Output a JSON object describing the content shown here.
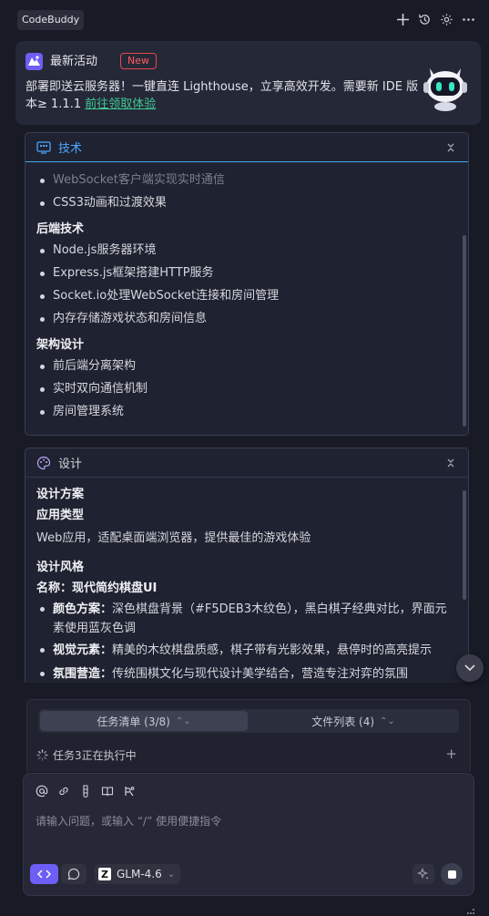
{
  "app": {
    "name": "CodeBuddy"
  },
  "header": {
    "icons": [
      "plus-icon",
      "history-icon",
      "settings-icon",
      "more-icon"
    ]
  },
  "banner": {
    "title": "最新活动",
    "badge": "New",
    "text": "部署即送云服务器！一键直连 Lighthouse，立享高效开发。需要新 IDE 版本≥ 1.1.1 ",
    "link": "前往领取体验"
  },
  "tech_card": {
    "title": "技术",
    "faded_item": "WebSocket客户端实现实时通信",
    "items_top": [
      "CSS3动画和过渡效果"
    ],
    "sections": [
      {
        "title": "后端技术",
        "items": [
          "Node.js服务器环境",
          "Express.js框架搭建HTTP服务",
          "Socket.io处理WebSocket连接和房间管理",
          "内存存储游戏状态和房间信息"
        ]
      },
      {
        "title": "架构设计",
        "items": [
          "前后端分离架构",
          "实时双向通信机制",
          "房间管理系统"
        ]
      }
    ]
  },
  "design_card": {
    "title": "设计",
    "plan_title": "设计方案",
    "app_type_title": "应用类型",
    "app_type_text": "Web应用，适配桌面端浏览器，提供最佳的游戏体验",
    "style_title": "设计风格",
    "name_line": "名称：现代简约棋盘UI",
    "items": [
      {
        "label": "颜色方案：",
        "text": "深色棋盘背景（#F5DEB3木纹色），黑白棋子经典对比，界面元素使用蓝灰色调"
      },
      {
        "label": "视觉元素：",
        "text": "精美的木纹棋盘质感，棋子带有光影效果，悬停时的高亮提示"
      },
      {
        "label": "氛围营造：",
        "text": "传统围棋文化与现代设计美学结合，营造专注对弈的氛围"
      }
    ]
  },
  "tasks": {
    "tab_tasks": "任务清单 (3/8)",
    "tab_files": "文件列表 (4)",
    "status": "任务3正在执行中"
  },
  "composer": {
    "placeholder": "请输入问题，或输入 “/” 使用便捷指令",
    "model": "GLM-4.6",
    "model_logo": "Z"
  },
  "colors": {
    "accent": "#6d5ef5",
    "link": "#3fc994",
    "badge": "#e5484d",
    "header_line": "#3da9f4"
  }
}
